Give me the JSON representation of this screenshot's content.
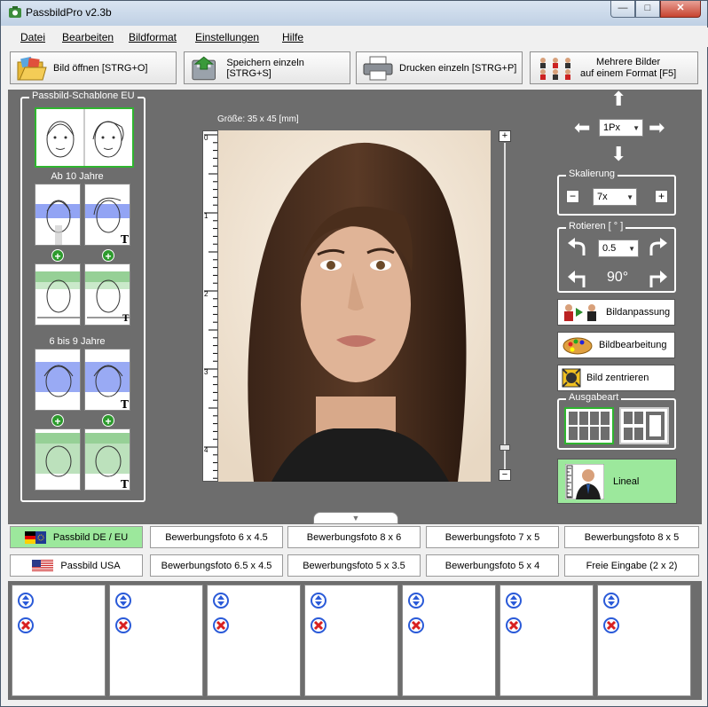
{
  "window": {
    "title": "PassbildPro  v2.3b",
    "min": "—",
    "max": "□",
    "close": "✕"
  },
  "menu": [
    "Datei",
    "Bearbeiten",
    "Bildformat",
    "Einstellungen",
    "Hilfe"
  ],
  "toolbar": {
    "open": "Bild öffnen [STRG+O]",
    "save": "Speichern einzeln [STRG+S]",
    "print": "Drucken einzeln [STRG+P]",
    "multi_line1": "Mehrere Bilder",
    "multi_line2": "auf einem Format [F5]"
  },
  "template_panel": {
    "title": "Passbild-Schablone EU",
    "section_age10": "Ab 10 Jahre",
    "section_age6": "6 bis 9 Jahre",
    "plus": "+",
    "t_mark": "T"
  },
  "canvas": {
    "size_label": "Größe: 35 x 45 [mm]",
    "ruler_ticks": [
      "0",
      "1",
      "2",
      "3",
      "4"
    ],
    "slider_plus": "+",
    "slider_minus": "−",
    "zoom_level": 0.94
  },
  "move": {
    "step": "1Px",
    "up": "⬆",
    "down": "⬇",
    "left": "⬅",
    "right": "➡"
  },
  "scale": {
    "title": "Skalierung",
    "value": "7x",
    "minus": "−",
    "plus": "+"
  },
  "rotate": {
    "title": "Rotieren [ ° ]",
    "value": "0.5",
    "ninety": "90°"
  },
  "side_buttons": {
    "adjust": "Bildanpassung",
    "edit": "Bildbearbeitung",
    "center": "Bild zentrieren"
  },
  "output": {
    "title": "Ausgabeart"
  },
  "lineal": "Lineal",
  "formats_row1": [
    "Passbild DE / EU",
    "Bewerbungsfoto 6 x 4.5",
    "Bewerbungsfoto 8 x 6",
    "Bewerbungsfoto 7 x 5",
    "Bewerbungsfoto 8 x 5"
  ],
  "formats_row2": [
    "Passbild USA",
    "Bewerbungsfoto 6.5 x 4.5",
    "Bewerbungsfoto 5 x 3.5",
    "Bewerbungsfoto 5 x 4",
    "Freie Eingabe (2 x 2)"
  ],
  "colors": {
    "active_green": "#9ce89c",
    "panel_gray": "#6d6d6d",
    "select_green": "#2fb52f"
  }
}
